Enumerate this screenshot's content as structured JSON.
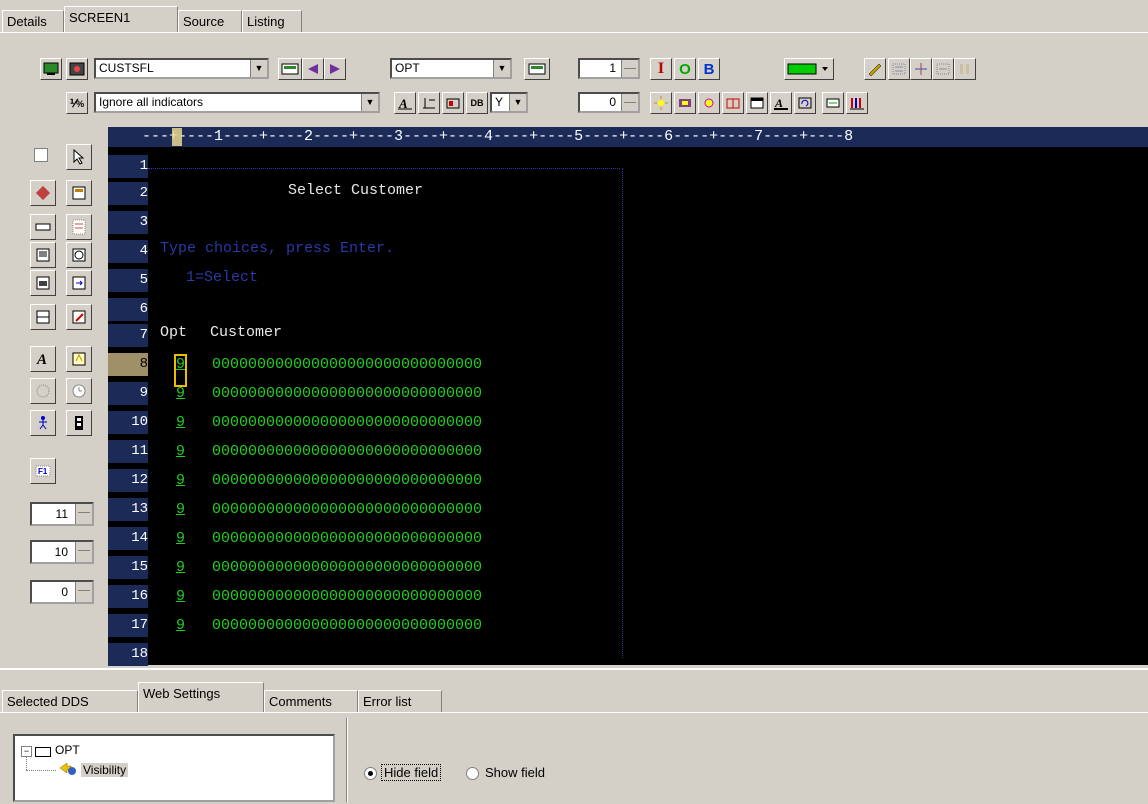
{
  "top_tabs": [
    "Details",
    "SCREEN1",
    "Source",
    "Listing"
  ],
  "toolbar": {
    "record_combo": "CUSTSFL",
    "field_combo": "OPT",
    "indicator_combo": "Ignore all indicators",
    "spin_top": "1",
    "spin_bottom": "0",
    "y_combo": "Y",
    "btn_i": "I",
    "btn_o": "O",
    "btn_b": "B",
    "btn_db": "DB"
  },
  "left_spins": [
    "11",
    "10",
    "0"
  ],
  "ruler": "---+----1----+----2----+----3----+----4----+----5----+----6----+----7----+----8",
  "line_numbers": [
    "1",
    "2",
    "3",
    "4",
    "5",
    "6",
    "7",
    "8",
    "9",
    "10",
    "11",
    "12",
    "13",
    "14",
    "15",
    "16",
    "17",
    "18"
  ],
  "screen": {
    "title": "Select Customer",
    "instructions": "Type choices, press Enter.",
    "option": "1=Select",
    "col_opt": "Opt",
    "col_customer": "Customer",
    "opt_value": "9",
    "customer_value": "000000000000000000000000000000"
  },
  "bottom_tabs": [
    "Selected DDS",
    "Web Settings",
    "Comments",
    "Error list"
  ],
  "tree": {
    "root": "OPT",
    "child": "Visibility"
  },
  "visibility": {
    "hide_label": "Hide field",
    "show_label": "Show field"
  },
  "colors": {
    "terminal_bg": "#000000",
    "ruler_bg": "#1c2a58",
    "field_green": "#22cc22",
    "instruction_blue": "#2a3aa8"
  }
}
